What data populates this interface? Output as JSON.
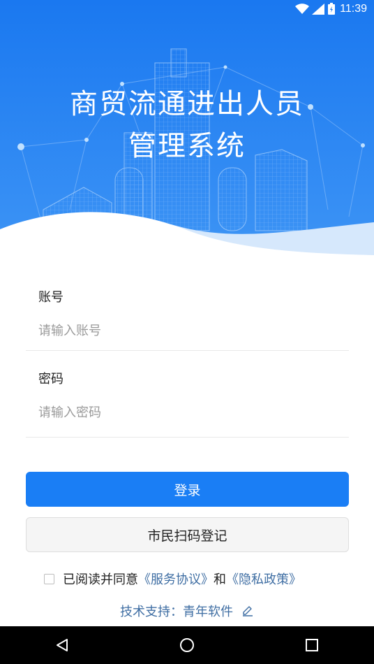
{
  "status_bar": {
    "time": "11:39"
  },
  "header": {
    "title_line1": "商贸流通进出人员",
    "title_line2": "管理系统"
  },
  "form": {
    "account_label": "账号",
    "account_placeholder": "请输入账号",
    "account_value": "",
    "password_label": "密码",
    "password_placeholder": "请输入密码",
    "password_value": ""
  },
  "buttons": {
    "login": "登录",
    "citizen_scan": "市民扫码登记"
  },
  "agreement": {
    "checked": false,
    "prefix": "已阅读并同意",
    "service_link": "《服务协议》",
    "and": "和",
    "privacy_link": "《隐私政策》"
  },
  "footer": {
    "support_text": "技术支持：青年软件"
  },
  "nav_bar": {
    "icons": [
      "back-icon",
      "home-icon",
      "recents-icon"
    ]
  },
  "colors": {
    "primary": "#1a7ef5",
    "header_top": "#1a78f0",
    "link": "#3f6ea3",
    "wave_light": "#d6e8fc"
  }
}
